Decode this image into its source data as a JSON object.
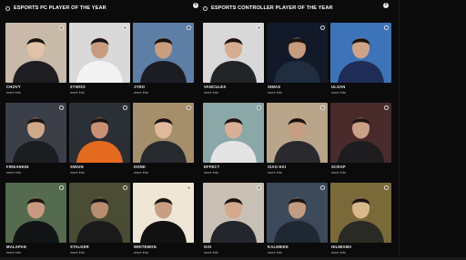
{
  "pc_section": {
    "title": "ESPORTS PC PLAYER OF THE YEAR",
    "players": [
      {
        "name": "CHOVY",
        "more": "more info"
      },
      {
        "name": "ZYWOO",
        "more": "more info"
      },
      {
        "name": "JYRO",
        "more": "more info"
      },
      {
        "name": "FIREANKIN",
        "more": "more info"
      },
      {
        "name": "SWAIN",
        "more": "more info"
      },
      {
        "name": "DONK",
        "more": "more info"
      },
      {
        "name": "MALAPAN",
        "more": "more info"
      },
      {
        "name": "STALKER",
        "more": "more info"
      },
      {
        "name": "WHITEMON",
        "more": "more info"
      }
    ]
  },
  "controller_section": {
    "title": "ESPORTS CONTROLLER PLAYER OF THE YEAR",
    "players": [
      {
        "name": "VANCULES",
        "more": "more info"
      },
      {
        "name": "SIMAS",
        "more": "more info"
      },
      {
        "name": "ULSAN",
        "more": "more info"
      },
      {
        "name": "EFFECT",
        "more": "more info"
      },
      {
        "name": "XIAO HAI",
        "more": "more info"
      },
      {
        "name": "SCRAP",
        "more": "more info"
      },
      {
        "name": "GOI",
        "more": "more info"
      },
      {
        "name": "KALEBIKE",
        "more": "more info"
      },
      {
        "name": "HILMIAMA",
        "more": "more info"
      }
    ]
  },
  "icons": {
    "info": "info-icon",
    "radio": "radio-icon"
  },
  "info_glyph": "i",
  "colors": {
    "background": "#0b0b0c",
    "text": "#ffffff",
    "muted": "#bdbdbd"
  }
}
